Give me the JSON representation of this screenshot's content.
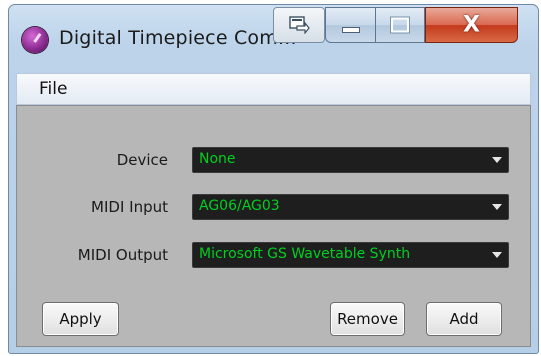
{
  "window": {
    "title": "Digital Timepiece Com...",
    "close_glyph": "X"
  },
  "menu": {
    "file": "File"
  },
  "form": {
    "device": {
      "label": "Device",
      "value": "None"
    },
    "midi_input": {
      "label": "MIDI Input",
      "value": "AG06/AG03"
    },
    "midi_output": {
      "label": "MIDI Output",
      "value": "Microsoft GS Wavetable Synth"
    }
  },
  "buttons": {
    "apply": "Apply",
    "remove": "Remove",
    "add": "Add"
  },
  "colors": {
    "combo_text": "#00d021",
    "client_bg": "#b7b7b7",
    "close_button": "#c4391c"
  },
  "icons": {
    "app": "clock-app-icon",
    "restore": "restore-window-icon",
    "minimize": "minimize-icon",
    "maximize": "maximize-icon",
    "close": "close-icon",
    "dropdown": "chevron-down-icon"
  }
}
